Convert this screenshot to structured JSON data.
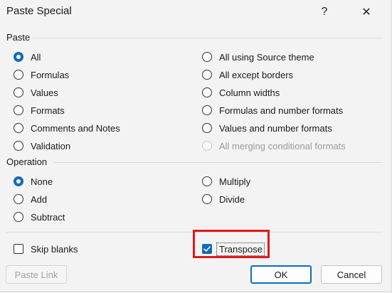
{
  "dialog": {
    "title": "Paste Special",
    "help_glyph": "?",
    "close_glyph": "✕"
  },
  "paste": {
    "section_label": "Paste",
    "left": [
      {
        "label": "All",
        "checked": true
      },
      {
        "label": "Formulas"
      },
      {
        "label": "Values"
      },
      {
        "label": "Formats"
      },
      {
        "label": "Comments and Notes"
      },
      {
        "label": "Validation"
      }
    ],
    "right": [
      {
        "label": "All using Source theme"
      },
      {
        "label": "All except borders"
      },
      {
        "label": "Column widths"
      },
      {
        "label": "Formulas and number formats"
      },
      {
        "label": "Values and number formats"
      },
      {
        "label": "All merging conditional formats",
        "disabled": true
      }
    ]
  },
  "operation": {
    "section_label": "Operation",
    "left": [
      {
        "label": "None",
        "checked": true
      },
      {
        "label": "Add"
      },
      {
        "label": "Subtract"
      }
    ],
    "right": [
      {
        "label": "Multiply"
      },
      {
        "label": "Divide"
      }
    ]
  },
  "options": {
    "skip_blanks": {
      "label": "Skip blanks",
      "checked": false
    },
    "transpose": {
      "label": "Transpose",
      "checked": true
    }
  },
  "buttons": {
    "paste_link": "Paste Link",
    "ok": "OK",
    "cancel": "Cancel"
  },
  "colors": {
    "accent": "#0f6cbd",
    "highlight": "#e21a1a"
  }
}
